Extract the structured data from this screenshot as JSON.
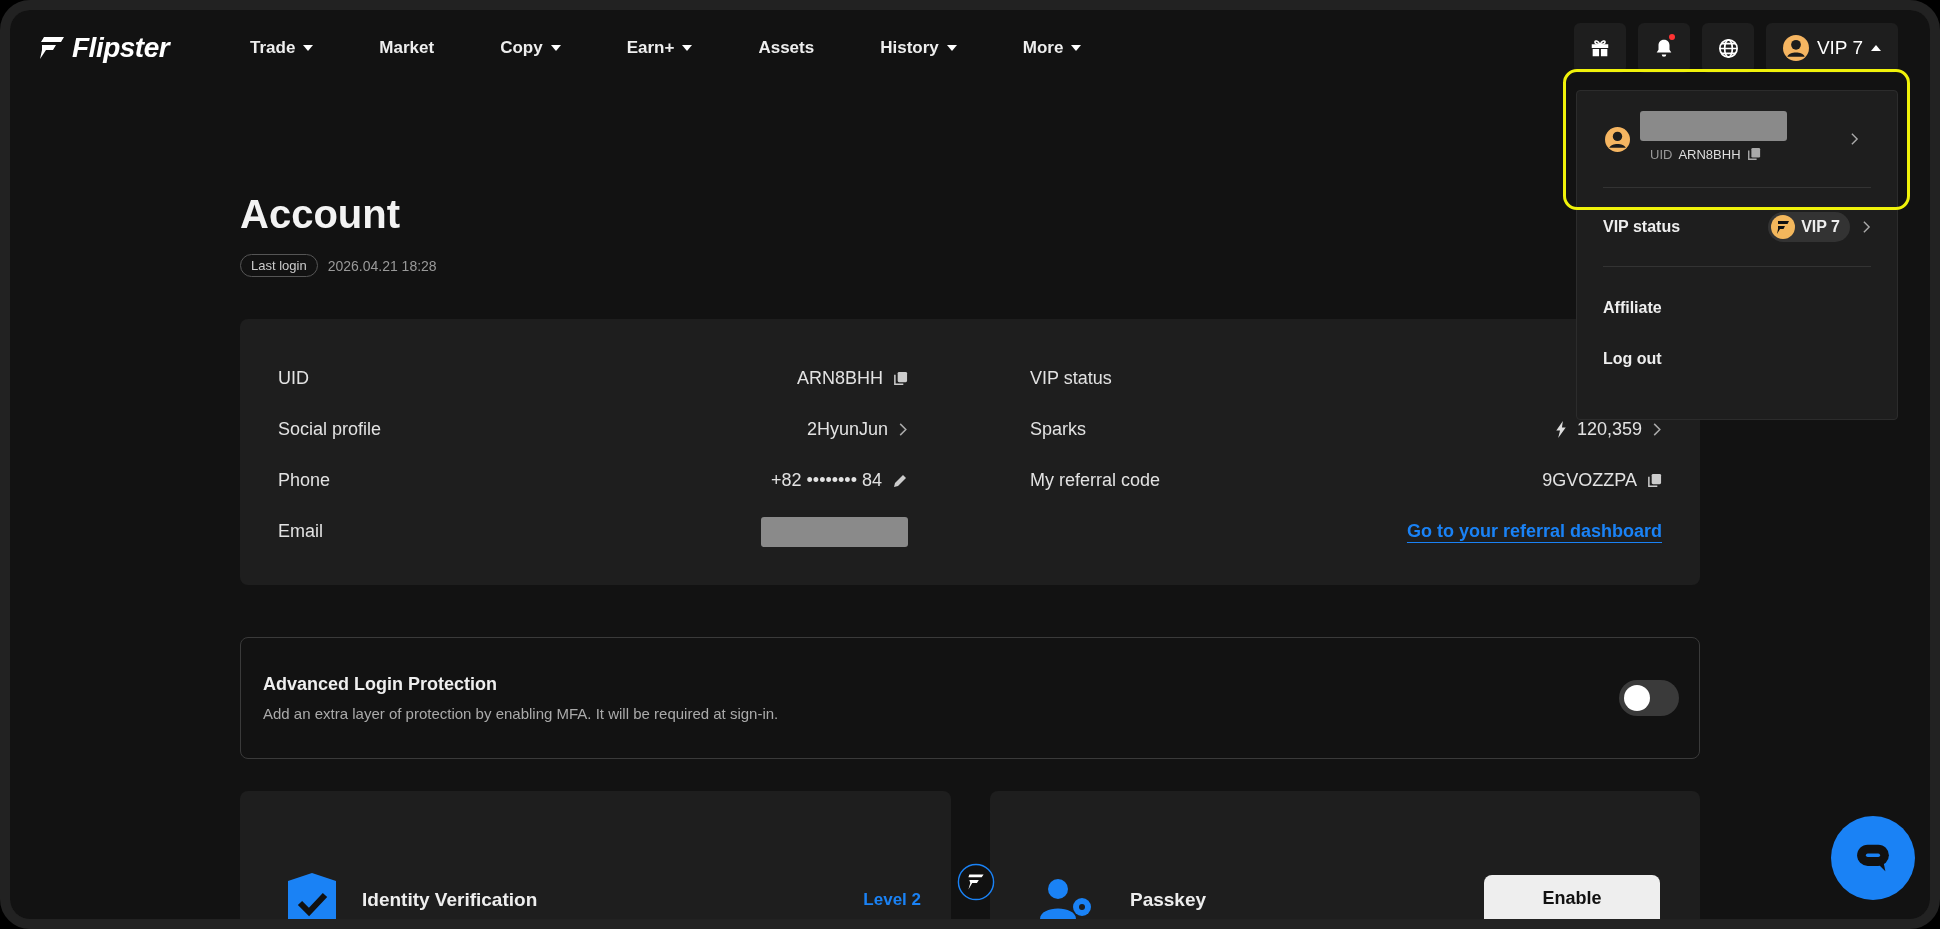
{
  "nav": {
    "logo": "Flipster",
    "items": [
      {
        "label": "Trade",
        "dropdown": true
      },
      {
        "label": "Market",
        "dropdown": false
      },
      {
        "label": "Copy",
        "dropdown": true
      },
      {
        "label": "Earn+",
        "dropdown": true
      },
      {
        "label": "Assets",
        "dropdown": false
      },
      {
        "label": "History",
        "dropdown": true
      },
      {
        "label": "More",
        "dropdown": true
      }
    ]
  },
  "header_actions": {
    "notification_unread": true,
    "account_label": "VIP 7",
    "menu_expanded": true
  },
  "account_menu": {
    "uid_label": "UID",
    "uid": "ARN8BHH",
    "vip_label": "VIP status",
    "vip_badge": "VIP 7",
    "items": [
      "Affiliate",
      "Log out"
    ]
  },
  "page": {
    "title": "Account",
    "last_login_label": "Last login",
    "last_login": "2026.04.21 18:28"
  },
  "info_left": [
    {
      "label": "UID",
      "value": "ARN8BHH",
      "kind": "copy"
    },
    {
      "label": "Social profile",
      "value": "2HyunJun",
      "kind": "link"
    },
    {
      "label": "Phone",
      "value": "+82 •••••••• 84",
      "kind": "edit"
    },
    {
      "label": "Email",
      "kind": "redacted"
    }
  ],
  "info_right": [
    {
      "label": "VIP status",
      "kind": "vip"
    },
    {
      "label": "Sparks",
      "value": "120,359",
      "kind": "sparks"
    },
    {
      "label": "My referral code",
      "value": "9GVOZZPA",
      "kind": "copy"
    }
  ],
  "referral_link": "Go to your referral dashboard",
  "security": {
    "title": "Advanced Login Protection",
    "description": "Add an extra layer of protection by enabling MFA. It will be required at sign-in.",
    "on": false
  },
  "cards": [
    {
      "kind": "identity",
      "title": "Identity Verification",
      "status": "Level 2"
    },
    {
      "kind": "passkey",
      "title": "Passkey",
      "button": "Enable"
    }
  ]
}
